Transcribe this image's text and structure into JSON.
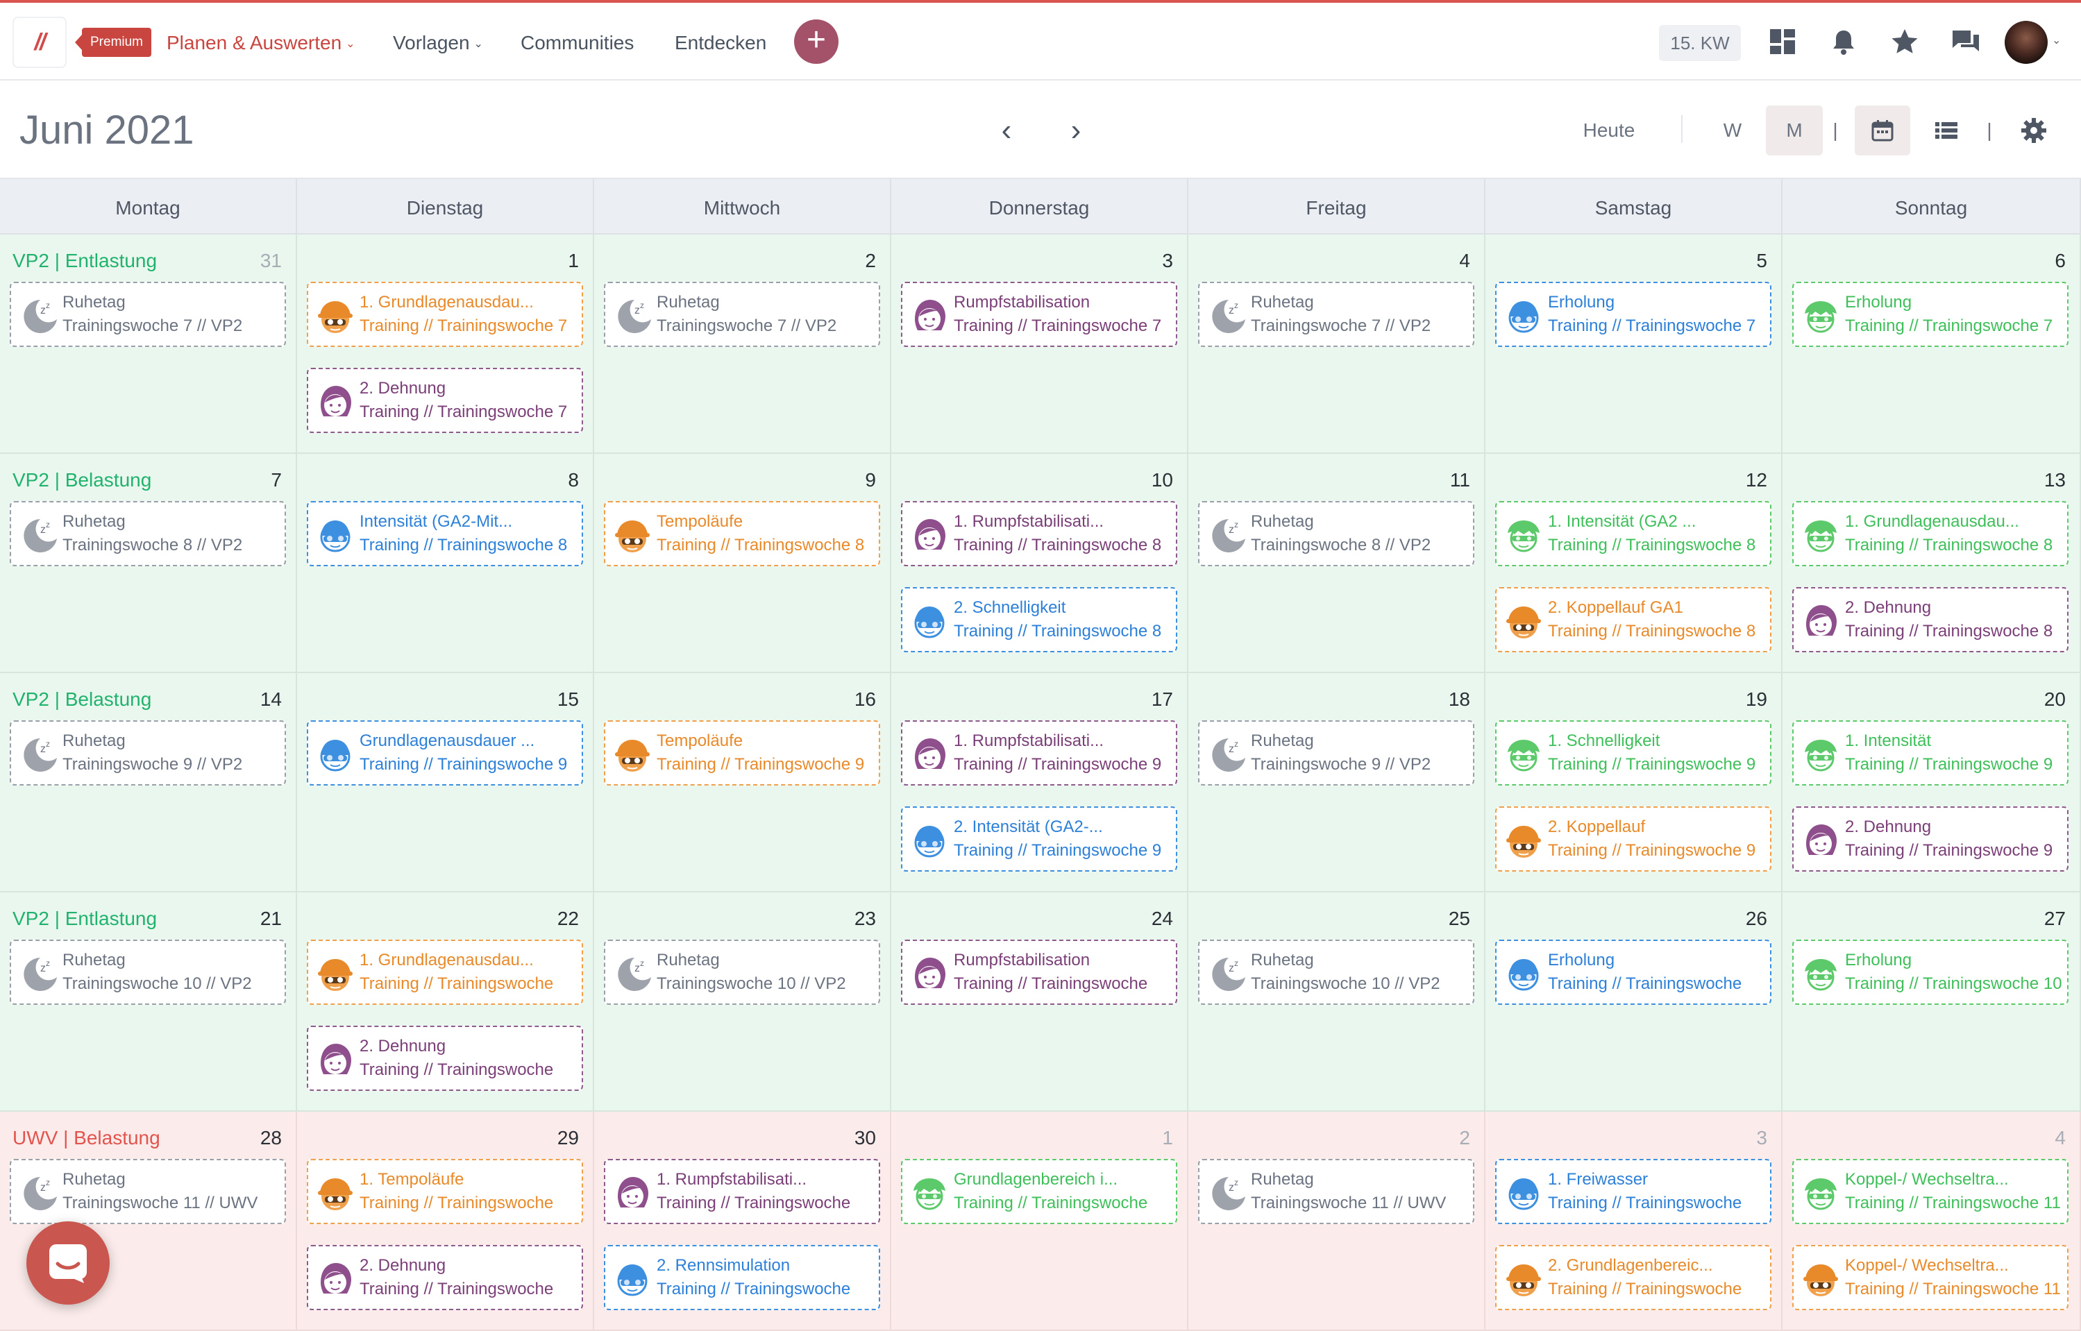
{
  "nav": {
    "logo": "//",
    "premium": "Premium",
    "links": [
      {
        "label": "Planen & Auswerten",
        "caret": "⌄",
        "active": true
      },
      {
        "label": "Vorlagen",
        "caret": "⌄",
        "active": false
      },
      {
        "label": "Communities",
        "caret": "",
        "active": false
      },
      {
        "label": "Entdecken",
        "caret": "",
        "active": false
      }
    ],
    "add_symbol": "+",
    "week_badge": "15. KW",
    "icons": [
      "dashboard-icon",
      "bell-icon",
      "star-icon",
      "chat-icon"
    ],
    "avatar_caret": "⌄"
  },
  "toolbar": {
    "month": "Juni 2021",
    "prev": "‹",
    "next": "›",
    "today": "Heute",
    "view_week": "W",
    "view_month": "M",
    "divider": "|"
  },
  "colors": {
    "brand": "#c9453f",
    "grey": "#6b7380",
    "orange": "#e88a2a",
    "purple": "#7b3f78",
    "blue": "#2d80d8",
    "green": "#3ebf5a",
    "week_green": "#21b36e",
    "week_red": "#e2544e"
  },
  "weekdays": [
    "Montag",
    "Dienstag",
    "Mittwoch",
    "Donnerstag",
    "Freitag",
    "Samstag",
    "Sonntag"
  ],
  "weeks": [
    {
      "label": "VP2 | Entlastung",
      "color": "green",
      "days": [
        {
          "n": "31",
          "dim": true,
          "events": [
            {
              "c": "grey",
              "i": "moon",
              "t": "Ruhetag",
              "s": "Trainingswoche 7 // VP2"
            }
          ]
        },
        {
          "n": "1",
          "events": [
            {
              "c": "orange",
              "i": "cap",
              "t": "1. Grundlagenausdau...",
              "s": "Training // Trainingswoche 7"
            },
            {
              "c": "purple",
              "i": "girl",
              "t": "2. Dehnung",
              "s": "Training // Trainingswoche 7"
            }
          ]
        },
        {
          "n": "2",
          "events": [
            {
              "c": "grey",
              "i": "moon",
              "t": "Ruhetag",
              "s": "Trainingswoche 7 // VP2"
            }
          ]
        },
        {
          "n": "3",
          "events": [
            {
              "c": "purple",
              "i": "girl",
              "t": "Rumpfstabilisation",
              "s": "Training // Trainingswoche 7"
            }
          ]
        },
        {
          "n": "4",
          "events": [
            {
              "c": "grey",
              "i": "moon",
              "t": "Ruhetag",
              "s": "Trainingswoche 7 // VP2"
            }
          ]
        },
        {
          "n": "5",
          "events": [
            {
              "c": "blue",
              "i": "swim",
              "t": "Erholung",
              "s": "Training // Trainingswoche 7"
            }
          ]
        },
        {
          "n": "6",
          "events": [
            {
              "c": "green",
              "i": "bike",
              "t": "Erholung",
              "s": "Training // Trainingswoche 7"
            }
          ]
        }
      ]
    },
    {
      "label": "VP2 | Belastung",
      "color": "green",
      "days": [
        {
          "n": "7",
          "events": [
            {
              "c": "grey",
              "i": "moon",
              "t": "Ruhetag",
              "s": "Trainingswoche 8 // VP2"
            }
          ]
        },
        {
          "n": "8",
          "events": [
            {
              "c": "blue",
              "i": "swim",
              "t": "Intensität (GA2-Mit...",
              "s": "Training // Trainingswoche 8"
            }
          ]
        },
        {
          "n": "9",
          "events": [
            {
              "c": "orange",
              "i": "cap",
              "t": "Tempoläufe",
              "s": "Training // Trainingswoche 8"
            }
          ]
        },
        {
          "n": "10",
          "events": [
            {
              "c": "purple",
              "i": "girl",
              "t": "1. Rumpfstabilisati...",
              "s": "Training // Trainingswoche 8"
            },
            {
              "c": "blue",
              "i": "swim",
              "t": "2. Schnelligkeit",
              "s": "Training // Trainingswoche 8"
            }
          ]
        },
        {
          "n": "11",
          "events": [
            {
              "c": "grey",
              "i": "moon",
              "t": "Ruhetag",
              "s": "Trainingswoche 8 // VP2"
            }
          ]
        },
        {
          "n": "12",
          "events": [
            {
              "c": "green",
              "i": "bike",
              "t": "1. Intensität (GA2 ...",
              "s": "Training // Trainingswoche 8"
            },
            {
              "c": "orange",
              "i": "cap",
              "t": "2. Koppellauf GA1",
              "s": "Training // Trainingswoche 8"
            }
          ]
        },
        {
          "n": "13",
          "events": [
            {
              "c": "green",
              "i": "bike",
              "t": "1. Grundlagenausdau...",
              "s": "Training // Trainingswoche 8"
            },
            {
              "c": "purple",
              "i": "girl",
              "t": "2. Dehnung",
              "s": "Training // Trainingswoche 8"
            }
          ]
        }
      ]
    },
    {
      "label": "VP2 | Belastung",
      "color": "green",
      "days": [
        {
          "n": "14",
          "events": [
            {
              "c": "grey",
              "i": "moon",
              "t": "Ruhetag",
              "s": "Trainingswoche 9 // VP2"
            }
          ]
        },
        {
          "n": "15",
          "events": [
            {
              "c": "blue",
              "i": "swim",
              "t": "Grundlagenausdauer ...",
              "s": "Training // Trainingswoche 9"
            }
          ]
        },
        {
          "n": "16",
          "events": [
            {
              "c": "orange",
              "i": "cap",
              "t": "Tempoläufe",
              "s": "Training // Trainingswoche 9"
            }
          ]
        },
        {
          "n": "17",
          "events": [
            {
              "c": "purple",
              "i": "girl",
              "t": "1. Rumpfstabilisati...",
              "s": "Training // Trainingswoche 9"
            },
            {
              "c": "blue",
              "i": "swim",
              "t": "2. Intensität (GA2-...",
              "s": "Training // Trainingswoche 9"
            }
          ]
        },
        {
          "n": "18",
          "events": [
            {
              "c": "grey",
              "i": "moon",
              "t": "Ruhetag",
              "s": "Trainingswoche 9 // VP2"
            }
          ]
        },
        {
          "n": "19",
          "events": [
            {
              "c": "green",
              "i": "bike",
              "t": "1. Schnelligkeit",
              "s": "Training // Trainingswoche 9"
            },
            {
              "c": "orange",
              "i": "cap",
              "t": "2. Koppellauf",
              "s": "Training // Trainingswoche 9"
            }
          ]
        },
        {
          "n": "20",
          "events": [
            {
              "c": "green",
              "i": "bike",
              "t": "1. Intensität",
              "s": "Training // Trainingswoche 9"
            },
            {
              "c": "purple",
              "i": "girl",
              "t": "2. Dehnung",
              "s": "Training // Trainingswoche 9"
            }
          ]
        }
      ]
    },
    {
      "label": "VP2 | Entlastung",
      "color": "green",
      "days": [
        {
          "n": "21",
          "events": [
            {
              "c": "grey",
              "i": "moon",
              "t": "Ruhetag",
              "s": "Trainingswoche 10 // VP2"
            }
          ]
        },
        {
          "n": "22",
          "events": [
            {
              "c": "orange",
              "i": "cap",
              "t": "1. Grundlagenausdau...",
              "s": "Training // Trainingswoche"
            },
            {
              "c": "purple",
              "i": "girl",
              "t": "2. Dehnung",
              "s": "Training // Trainingswoche"
            }
          ]
        },
        {
          "n": "23",
          "events": [
            {
              "c": "grey",
              "i": "moon",
              "t": "Ruhetag",
              "s": "Trainingswoche 10 // VP2"
            }
          ]
        },
        {
          "n": "24",
          "events": [
            {
              "c": "purple",
              "i": "girl",
              "t": "Rumpfstabilisation",
              "s": "Training // Trainingswoche"
            }
          ]
        },
        {
          "n": "25",
          "events": [
            {
              "c": "grey",
              "i": "moon",
              "t": "Ruhetag",
              "s": "Trainingswoche 10 // VP2"
            }
          ]
        },
        {
          "n": "26",
          "events": [
            {
              "c": "blue",
              "i": "swim",
              "t": "Erholung",
              "s": "Training // Trainingswoche"
            }
          ]
        },
        {
          "n": "27",
          "events": [
            {
              "c": "green",
              "i": "bike",
              "t": "Erholung",
              "s": "Training // Trainingswoche 10"
            }
          ]
        }
      ]
    },
    {
      "label": "UWV | Belastung",
      "color": "red",
      "days": [
        {
          "n": "28",
          "events": [
            {
              "c": "grey",
              "i": "moon",
              "t": "Ruhetag",
              "s": "Trainingswoche 11 // UWV"
            }
          ]
        },
        {
          "n": "29",
          "events": [
            {
              "c": "orange",
              "i": "cap",
              "t": "1. Tempoläufe",
              "s": "Training // Trainingswoche"
            },
            {
              "c": "purple",
              "i": "girl",
              "t": "2. Dehnung",
              "s": "Training // Trainingswoche"
            }
          ]
        },
        {
          "n": "30",
          "events": [
            {
              "c": "purple",
              "i": "girl",
              "t": "1. Rumpfstabilisati...",
              "s": "Training // Trainingswoche"
            },
            {
              "c": "blue",
              "i": "swim",
              "t": "2. Rennsimulation",
              "s": "Training // Trainingswoche"
            }
          ]
        },
        {
          "n": "1",
          "dim": true,
          "events": [
            {
              "c": "green",
              "i": "bike",
              "t": "Grundlagenbereich i...",
              "s": "Training // Trainingswoche"
            }
          ]
        },
        {
          "n": "2",
          "dim": true,
          "events": [
            {
              "c": "grey",
              "i": "moon",
              "t": "Ruhetag",
              "s": "Trainingswoche 11 // UWV"
            }
          ]
        },
        {
          "n": "3",
          "dim": true,
          "events": [
            {
              "c": "blue",
              "i": "swim",
              "t": "1. Freiwasser",
              "s": "Training // Trainingswoche"
            },
            {
              "c": "orange",
              "i": "cap",
              "t": "2. Grundlagenbereic...",
              "s": "Training // Trainingswoche"
            }
          ]
        },
        {
          "n": "4",
          "dim": true,
          "events": [
            {
              "c": "green",
              "i": "bike",
              "t": "Koppel-/ Wechseltra...",
              "s": "Training // Trainingswoche 11"
            },
            {
              "c": "orange",
              "i": "cap",
              "t": "Koppel-/ Wechseltra...",
              "s": "Training // Trainingswoche 11"
            }
          ]
        }
      ]
    }
  ]
}
